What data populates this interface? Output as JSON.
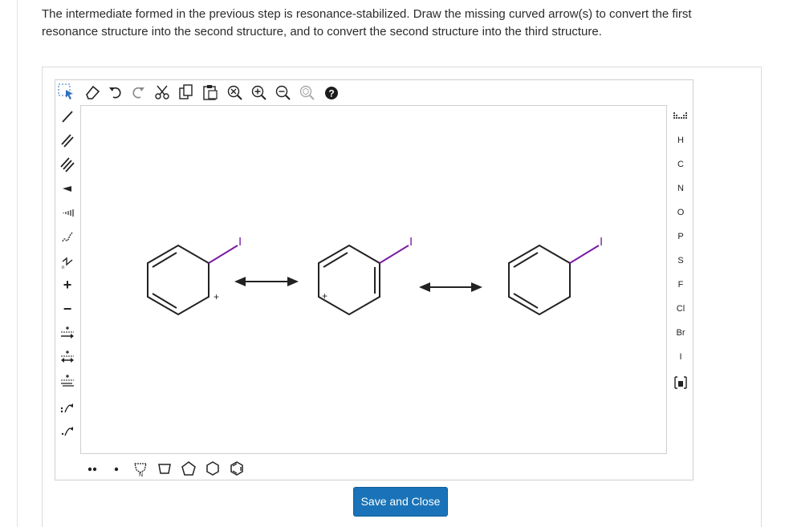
{
  "question": {
    "text": "The intermediate formed in the previous step is resonance-stabilized. Draw the missing curved arrow(s) to convert the first resonance structure into the second structure, and to convert the second structure into the third structure."
  },
  "top_toolbar": {
    "icons": [
      "select-icon",
      "eraser-icon",
      "undo-icon",
      "redo-icon",
      "cut-icon",
      "copy-icon",
      "paste-icon",
      "clear-icon",
      "zoom-in-icon",
      "zoom-out-icon",
      "zoom-fit-icon",
      "help-icon"
    ]
  },
  "left_toolbar": {
    "icons": [
      "single-bond-icon",
      "double-bond-icon",
      "triple-bond-icon",
      "wedge-bond-icon",
      "hash-bond-icon",
      "wavy-bond-icon",
      "chain-icon",
      "positive-charge-icon",
      "negative-charge-icon",
      "resonance-arrow-icon",
      "reaction-arrow-icon",
      "equilibrium-arrow-icon",
      "electron-pair-arrow-icon",
      "single-electron-arrow-icon"
    ],
    "charge_plus": "+",
    "charge_minus": "−"
  },
  "right_toolbar": {
    "atoms": [
      "H",
      "C",
      "N",
      "O",
      "P",
      "S",
      "F",
      "Cl",
      "Br",
      "I"
    ]
  },
  "bottom_toolbar": {
    "icons": [
      "lone-pair-icon",
      "radical-icon",
      "template-icon",
      "cyclopropane-icon",
      "cyclobutane-icon",
      "cyclopentane-icon",
      "cyclohexane-icon",
      "benzene-icon"
    ]
  },
  "canvas": {
    "structures": [
      {
        "substituent": "I",
        "charge": "+"
      },
      {
        "substituent": "I",
        "charge": "+"
      },
      {
        "substituent": "I",
        "charge": ""
      }
    ]
  },
  "colors": {
    "iodine_bond": "#7a1aa3",
    "iodine_label": "#7a1aa3",
    "button": "#1a73b8"
  },
  "save_button": {
    "label": "Save and Close"
  }
}
